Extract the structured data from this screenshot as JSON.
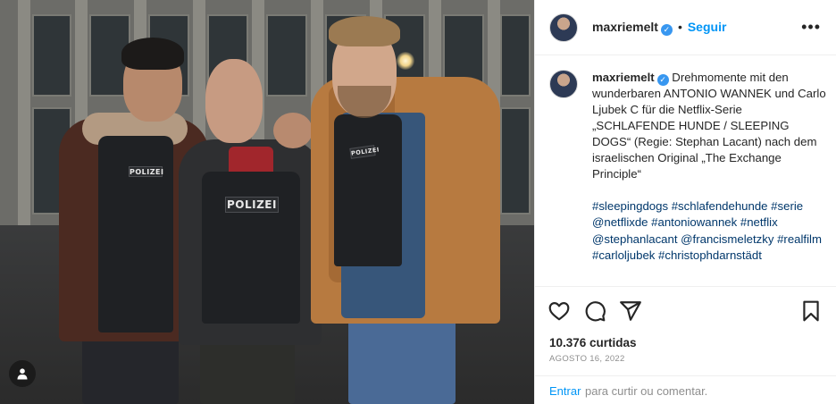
{
  "post": {
    "username": "maxriemelt",
    "separator": "•",
    "follow_label": "Seguir",
    "more_icon": "•••",
    "caption_text": " Drehmomente mit den wunderbaren ANTONIO WANNEK und Carlo Ljubek C für die Netflix-Serie „SCHLAFENDE HUNDE / SLEEPING DOGS“ (Regie: Stephan Lacant) nach dem israelischen Original „The Exchange Principle“",
    "hashtags": "#sleepingdogs #schlafendehunde #serie @netflixde #antoniowannek #netflix @stephanlacant @francismeletzky #realfilm #carloljubek #christophdarnstädt",
    "likes": "10.376 curtidas",
    "date": "AGOSTO 16, 2022",
    "comment_login": "Entrar",
    "comment_rest": "para curtir ou comentar."
  },
  "photo": {
    "vest_label_left": "POLIZEI",
    "vest_label_center": "POLIZEI",
    "vest_label_right": "POLIZEI"
  },
  "icons": {
    "like": "heart-icon",
    "comment": "comment-icon",
    "share": "share-icon",
    "save": "bookmark-icon",
    "verified": "verified-badge-icon",
    "user_tags": "user-tag-icon"
  },
  "colors": {
    "accent": "#0095f6",
    "link": "#00376b",
    "verified": "#3897f0",
    "muted": "#8e8e8e"
  }
}
